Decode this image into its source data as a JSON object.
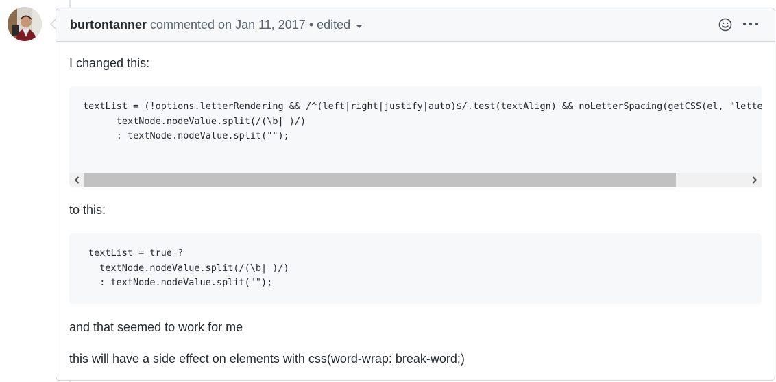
{
  "comment": {
    "author": "burtontanner",
    "action": " commented on Jan 11, 2017 • edited",
    "icons": {
      "reaction": "smiley-icon",
      "more": "kebab-horizontal-icon",
      "menu": "caret-down-icon"
    }
  },
  "body": {
    "intro": "I changed this:",
    "code_before": "textList = (!options.letterRendering && /^(left|right|justify|auto)$/.test(textAlign) && noLetterSpacing(getCSS(el, \"letterS\n      textNode.nodeValue.split(/(\\b| )/)\n      : textNode.nodeValue.split(\"\");",
    "middle": "to this:",
    "code_after": "textList = true ?\n  textNode.nodeValue.split(/(\\b| )/)\n  : textNode.nodeValue.split(\"\");",
    "para1": "and that seemed to work for me",
    "para2": "this will have a side effect on elements with css(word-wrap: break-word;)"
  },
  "colors": {
    "header_bg": "#f6f8fa",
    "border": "#d1d5da",
    "code_bg": "#f6f8fa",
    "text": "#24292e",
    "muted": "#586069"
  }
}
